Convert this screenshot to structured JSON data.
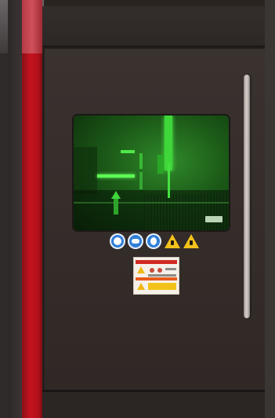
{
  "scene": {
    "subject": "laser-cutting-machine-door",
    "accent_colors": {
      "red_pillar": "#c4131f",
      "door": "#342c29",
      "window_glow": "#3fd63a",
      "safety_blue": "#2f7fd8",
      "warning_yellow": "#f3c21a"
    }
  },
  "window": {
    "tint": "green-laser-shield"
  },
  "safety_icons": [
    {
      "name": "mandatory-sign-icon",
      "kind": "circle",
      "color": "#2f7fd8"
    },
    {
      "name": "goggles-sign-icon",
      "kind": "circle",
      "color": "#2f7fd8"
    },
    {
      "name": "gloves-sign-icon",
      "kind": "circle",
      "color": "#2f7fd8"
    },
    {
      "name": "warning-triangle-icon",
      "kind": "triangle",
      "color": "#f3c21a"
    },
    {
      "name": "laser-hazard-icon",
      "kind": "triangle",
      "color": "#f3c21a"
    }
  ],
  "warning_label": {
    "colors": [
      "#d12a23",
      "#f0b914",
      "#e85b1c"
    ]
  }
}
